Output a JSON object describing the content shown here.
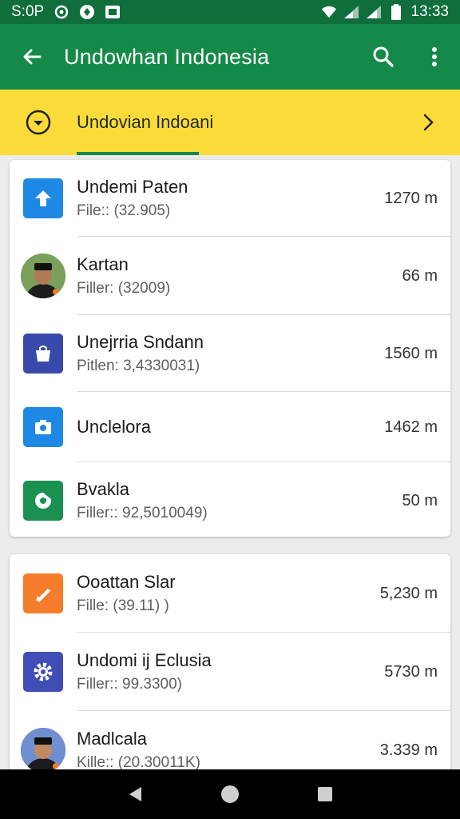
{
  "status_bar": {
    "time": "S:0P",
    "clock": "13:33"
  },
  "app_bar": {
    "title": "Undowhan Indonesia"
  },
  "banner": {
    "text": "Undovian Indoani"
  },
  "cards": [
    {
      "items": [
        {
          "name": "Undemi Paten",
          "sub": "File:: (32.905)",
          "size": "1270 m",
          "icon": "upload-icon",
          "color": "#1e88e5"
        },
        {
          "name": "Kartan",
          "sub": "Filler: (32009)",
          "size": "66 m",
          "icon": "avatar-person",
          "color": "#5c7a3a"
        },
        {
          "name": "Unejrria Sndann",
          "sub": "Pitlen: 3,4330031)",
          "size": "1560 m",
          "icon": "bag-icon",
          "color": "#3949ab"
        },
        {
          "name": "Unclelora",
          "sub": "",
          "size": "1462 m",
          "icon": "camera-icon",
          "color": "#1e88e5"
        },
        {
          "name": "Bvakla",
          "sub": "Filler:: 92,5010049)",
          "size": "50 m",
          "icon": "donut-icon",
          "color": "#1a9150"
        }
      ]
    },
    {
      "items": [
        {
          "name": "Ooattan Slar",
          "sub": "Fille: (39.11)       )",
          "size": "5,230 m",
          "icon": "pencil-icon",
          "color": "#f57c2a"
        },
        {
          "name": "Undomi ij Eclusia",
          "sub": "Filler:: 99.3300)",
          "size": "5730 m",
          "icon": "gear-icon",
          "color": "#3f4db5"
        },
        {
          "name": "Madlcala",
          "sub": "Kille:: (20.30011K)",
          "size": "3.339 m",
          "icon": "avatar-person",
          "color": "#4a6fb0"
        }
      ]
    }
  ],
  "colors": {
    "app_bar": "#158a48",
    "status_bar": "#0f6e3b",
    "banner": "#fbdb3a"
  }
}
